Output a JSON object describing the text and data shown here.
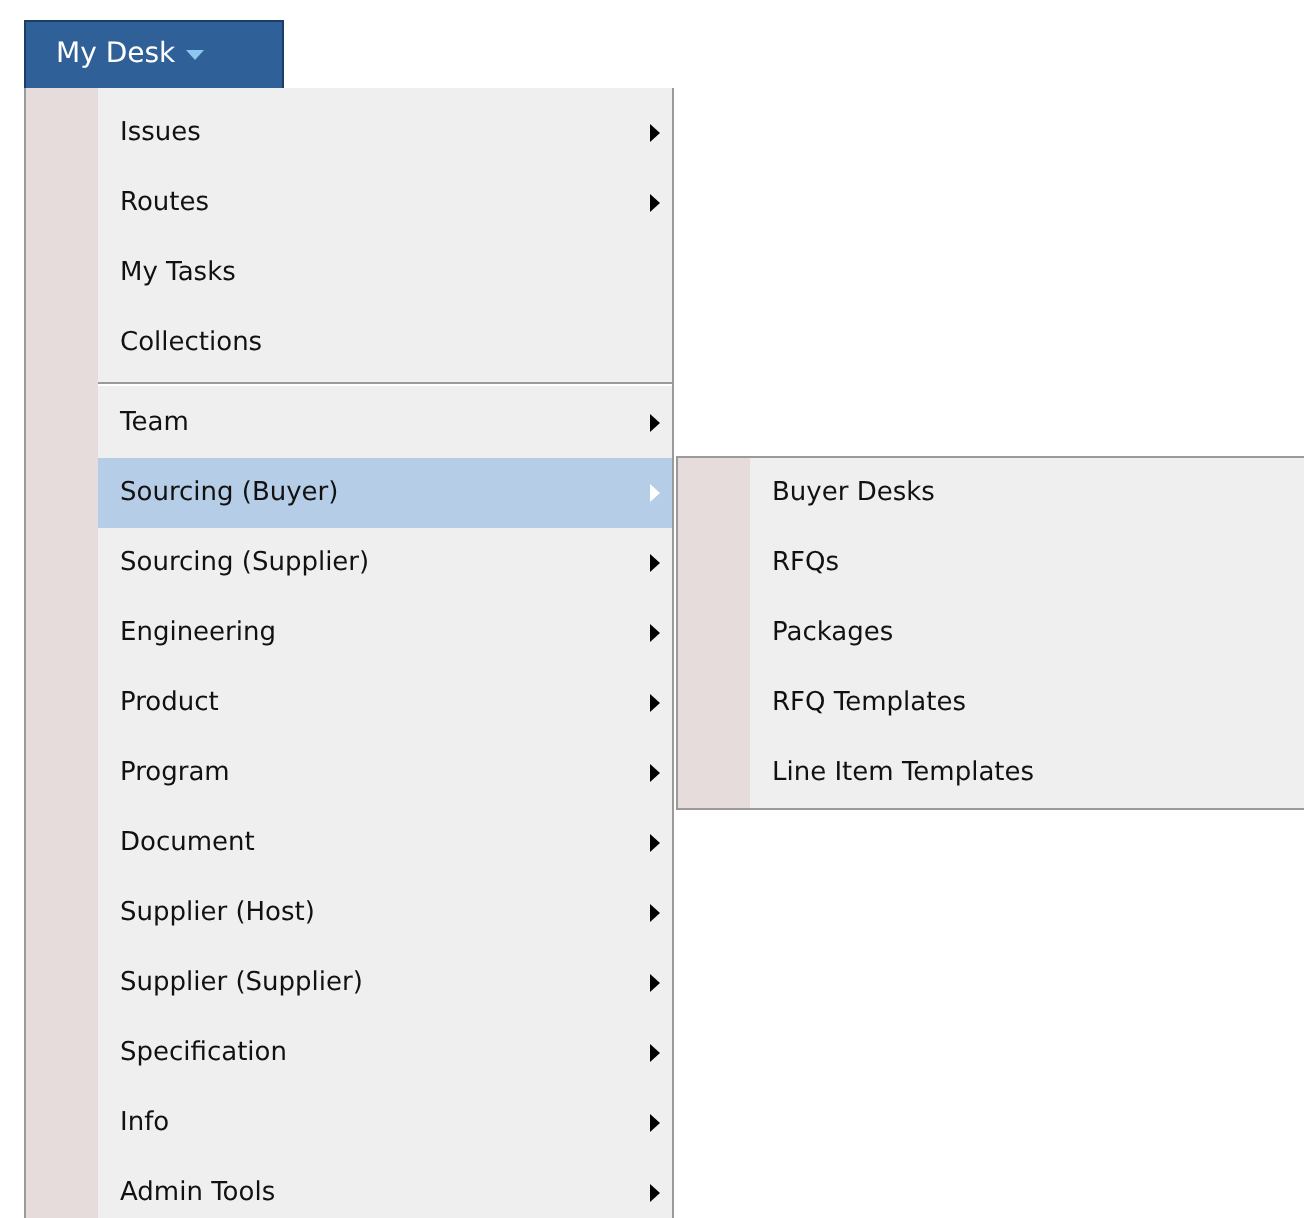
{
  "menu_button": {
    "label": "My Desk",
    "expanded": true
  },
  "menu": {
    "items": [
      {
        "label": "Issues",
        "has_submenu": true,
        "selected": false,
        "divider_before": false
      },
      {
        "label": "Routes",
        "has_submenu": true,
        "selected": false,
        "divider_before": false
      },
      {
        "label": "My Tasks",
        "has_submenu": false,
        "selected": false,
        "divider_before": false
      },
      {
        "label": "Collections",
        "has_submenu": false,
        "selected": false,
        "divider_before": false
      },
      {
        "label": "Team",
        "has_submenu": true,
        "selected": false,
        "divider_before": true
      },
      {
        "label": "Sourcing (Buyer)",
        "has_submenu": true,
        "selected": true,
        "divider_before": false,
        "children": [
          {
            "label": "Buyer Desks"
          },
          {
            "label": "RFQs"
          },
          {
            "label": "Packages"
          },
          {
            "label": "RFQ Templates"
          },
          {
            "label": "Line Item Templates"
          }
        ]
      },
      {
        "label": "Sourcing (Supplier)",
        "has_submenu": true,
        "selected": false,
        "divider_before": false
      },
      {
        "label": "Engineering",
        "has_submenu": true,
        "selected": false,
        "divider_before": false
      },
      {
        "label": "Product",
        "has_submenu": true,
        "selected": false,
        "divider_before": false
      },
      {
        "label": "Program",
        "has_submenu": true,
        "selected": false,
        "divider_before": false
      },
      {
        "label": "Document",
        "has_submenu": true,
        "selected": false,
        "divider_before": false
      },
      {
        "label": "Supplier (Host)",
        "has_submenu": true,
        "selected": false,
        "divider_before": false
      },
      {
        "label": "Supplier (Supplier)",
        "has_submenu": true,
        "selected": false,
        "divider_before": false
      },
      {
        "label": "Specification",
        "has_submenu": true,
        "selected": false,
        "divider_before": false
      },
      {
        "label": "Info",
        "has_submenu": true,
        "selected": false,
        "divider_before": false
      },
      {
        "label": "Admin Tools",
        "has_submenu": true,
        "selected": false,
        "divider_before": false
      }
    ]
  }
}
